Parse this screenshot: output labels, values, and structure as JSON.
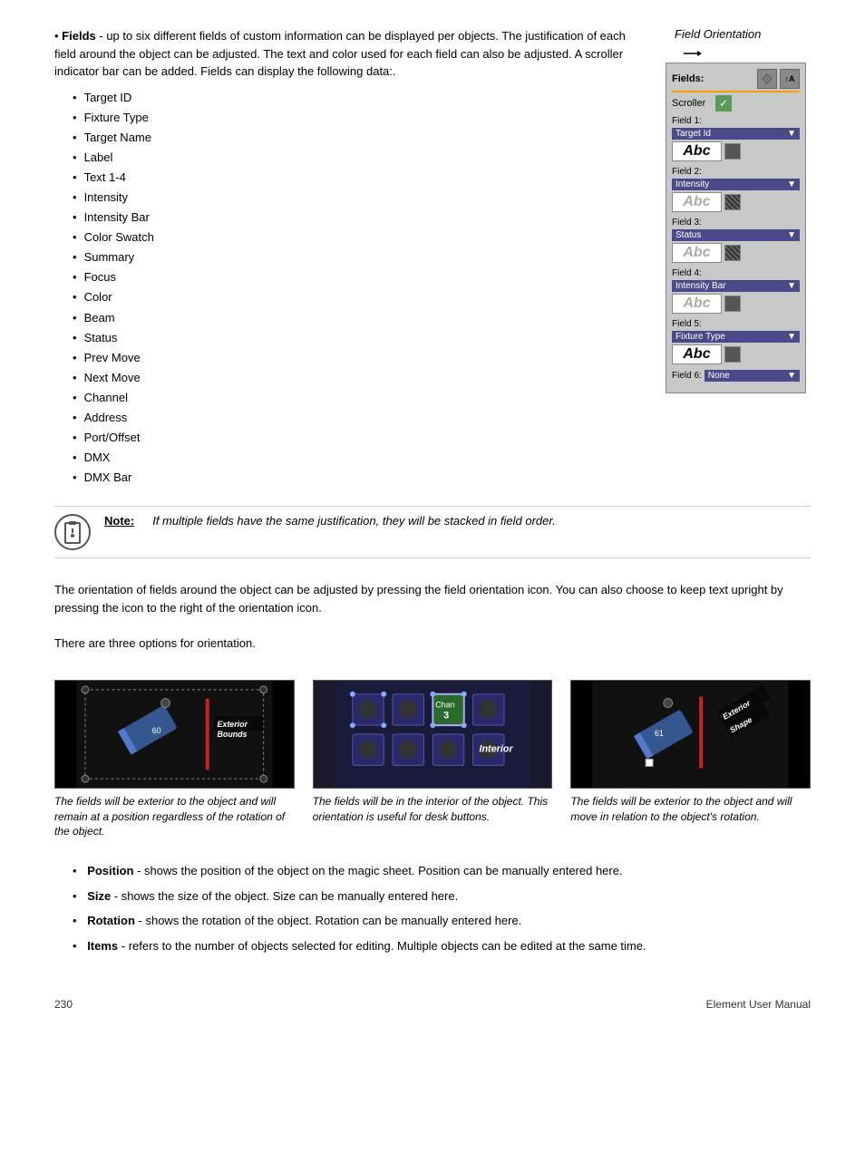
{
  "page": {
    "number": "230",
    "title": "Element User Manual"
  },
  "intro": {
    "bullet": "Fields",
    "text": "- up to six different fields of custom information can be displayed per objects. The justification of each field around the object can be adjusted. The text and color used for each field can also be adjusted. A scroller indicator bar can be added. Fields can display the following data:."
  },
  "field_list": [
    "Target ID",
    "Fixture Type",
    "Target Name",
    "Label",
    "Text 1-4",
    "Intensity",
    "Intensity Bar",
    "Color Swatch",
    "Summary",
    "Focus",
    "Color",
    "Beam",
    "Status",
    "Prev Move",
    "Next Move",
    "Channel",
    "Address",
    "Port/Offset",
    "DMX",
    "DMX Bar"
  ],
  "panel": {
    "orientation_label": "Field Orientation",
    "fields_label": "Fields:",
    "scroller_label": "Scroller",
    "field_rows": [
      {
        "label": "Field 1:",
        "select": "Target Id",
        "abc": "Abc",
        "faded": false
      },
      {
        "label": "Field 2:",
        "select": "Intensity",
        "abc": "Abc",
        "faded": true
      },
      {
        "label": "Field 3:",
        "select": "Status",
        "abc": "Abc",
        "faded": true
      },
      {
        "label": "Field 4:",
        "select": "Intensity Bar",
        "abc": "Abc",
        "faded": true
      },
      {
        "label": "Field 5:",
        "select": "Fixture Type",
        "abc": "Abc",
        "faded": false
      },
      {
        "label": "Field 6:",
        "select": "None",
        "abc": "",
        "faded": true
      }
    ]
  },
  "note": {
    "label": "Note:",
    "text": "If multiple fields have the same justification, they will be stacked in field order."
  },
  "orientation": {
    "body1": "The orientation of fields around the object can be adjusted by pressing the field orientation icon. You can also choose to keep text upright by pressing the icon to the right of the orientation icon.",
    "body2": "There are three options for orientation.",
    "items": [
      {
        "title": "Exterior\nBounds",
        "caption": "The fields will be exterior to the object and will remain at a position regardless of the rotation of the object.",
        "type": "exterior-bounds"
      },
      {
        "title": "Interior",
        "caption": "The fields will be in the interior of the object. This orientation is useful for desk buttons.",
        "type": "interior"
      },
      {
        "title": "Exterior\nShape",
        "caption": "The fields will be exterior to the object and will move in relation to the object's rotation.",
        "type": "exterior-shape"
      }
    ]
  },
  "bottom_bullets": [
    {
      "label": "Position",
      "text": "- shows the position of the object on the magic sheet. Position can be manually entered here."
    },
    {
      "label": "Size",
      "text": "- shows the size of the object. Size can be manually entered here."
    },
    {
      "label": "Rotation",
      "text": "- shows the rotation of the object. Rotation can be manually entered here."
    },
    {
      "label": "Items",
      "text": "- refers to the number of objects selected for editing. Multiple objects can be edited at the same time."
    }
  ]
}
